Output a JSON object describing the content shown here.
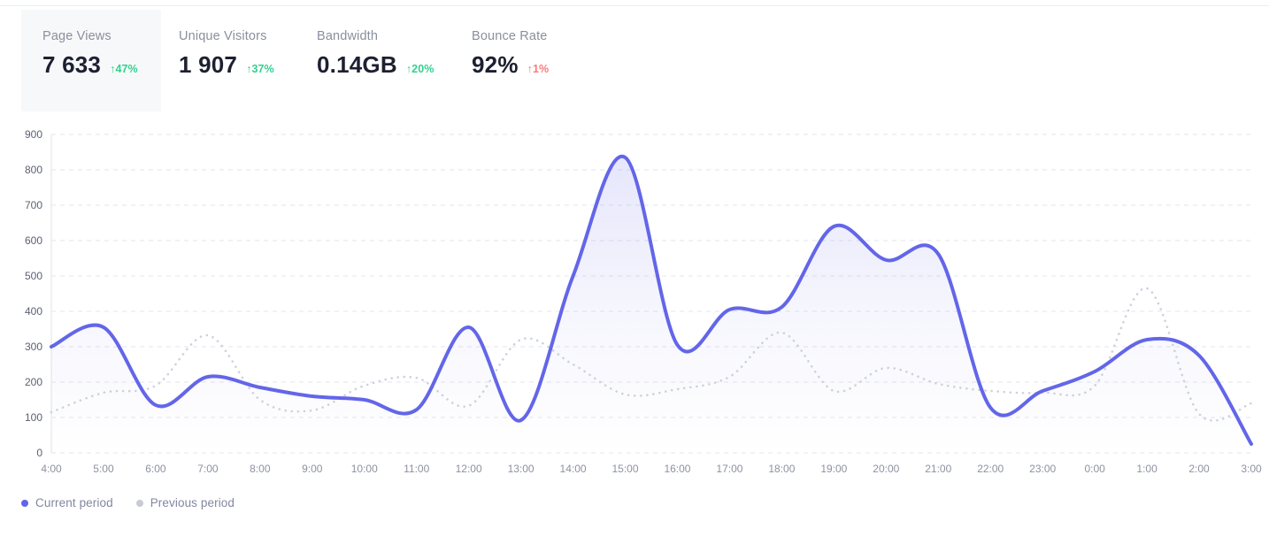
{
  "stats": [
    {
      "label": "Page Views",
      "value": "7 633",
      "delta": "47%",
      "direction": "up",
      "arrow": "↑",
      "active": true
    },
    {
      "label": "Unique Visitors",
      "value": "1 907",
      "delta": "37%",
      "direction": "up",
      "arrow": "↑",
      "active": false
    },
    {
      "label": "Bandwidth",
      "value": "0.14GB",
      "delta": "20%",
      "direction": "up",
      "arrow": "↑",
      "active": false
    },
    {
      "label": "Bounce Rate",
      "value": "92%",
      "delta": "1%",
      "direction": "down",
      "arrow": "↑",
      "active": false
    }
  ],
  "legend": [
    {
      "label": "Current period",
      "color": "#6366e8"
    },
    {
      "label": "Previous period",
      "color": "#c8cbd4"
    }
  ],
  "colors": {
    "current_line": "#6366e8",
    "previous_line": "#ccd2dc",
    "area_top": "#6366e8",
    "grid": "#e3e6ec",
    "axis": "#dfe3ea",
    "positive": "#35d08e",
    "negative": "#fa7a7a",
    "card_active_bg": "#f7f8fa"
  },
  "chart_data": {
    "type": "area",
    "title": "",
    "xlabel": "",
    "ylabel": "",
    "ylim": [
      0,
      900
    ],
    "ytick_step": 100,
    "yticks": [
      0,
      100,
      200,
      300,
      400,
      500,
      600,
      700,
      800,
      900
    ],
    "grid": "horizontal-dashed",
    "legend_position": "bottom-left",
    "categories": [
      "4:00",
      "5:00",
      "6:00",
      "7:00",
      "8:00",
      "9:00",
      "10:00",
      "11:00",
      "12:00",
      "13:00",
      "14:00",
      "15:00",
      "16:00",
      "17:00",
      "18:00",
      "19:00",
      "20:00",
      "21:00",
      "22:00",
      "23:00",
      "0:00",
      "1:00",
      "2:00",
      "3:00"
    ],
    "series": [
      {
        "name": "Current period",
        "style": "solid-filled",
        "color": "#6366e8",
        "values": [
          300,
          355,
          135,
          215,
          185,
          160,
          150,
          122,
          355,
          92,
          500,
          835,
          305,
          405,
          412,
          640,
          545,
          562,
          128,
          175,
          230,
          320,
          275,
          25
        ]
      },
      {
        "name": "Previous period",
        "style": "dotted",
        "color": "#ccd2dc",
        "values": [
          115,
          170,
          190,
          332,
          150,
          120,
          190,
          212,
          133,
          320,
          250,
          165,
          180,
          215,
          340,
          175,
          240,
          195,
          175,
          170,
          190,
          465,
          110,
          140
        ]
      }
    ]
  }
}
